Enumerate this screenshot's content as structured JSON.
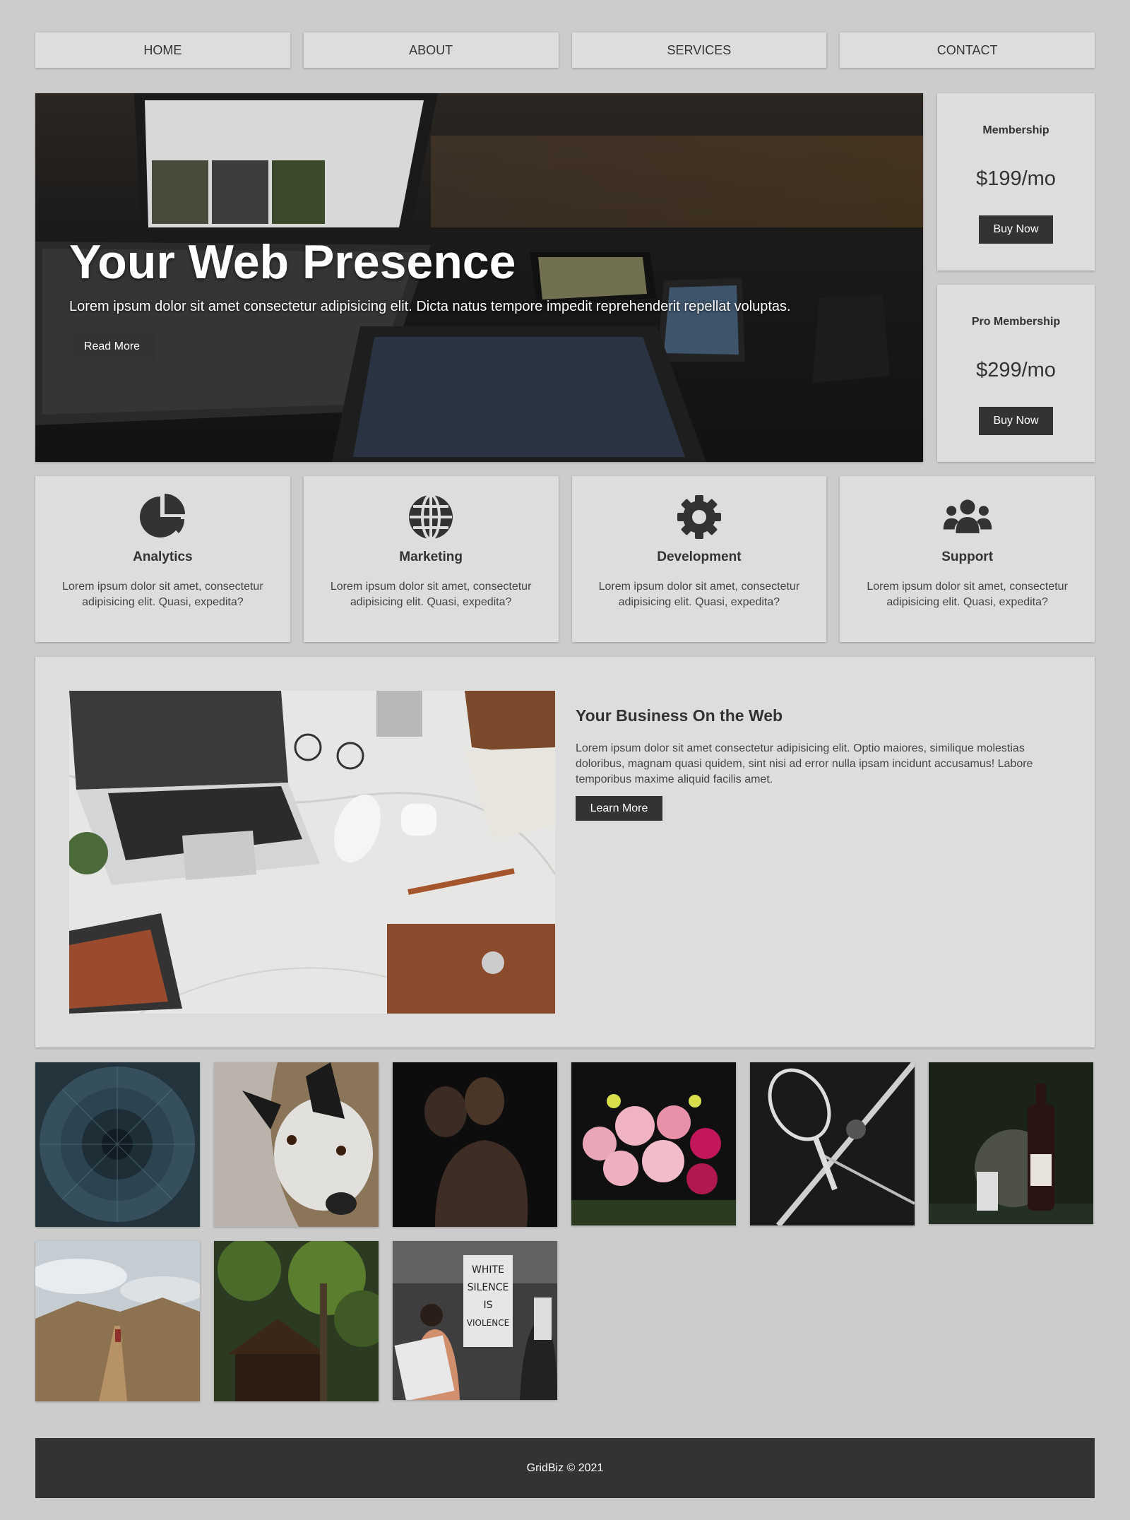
{
  "nav": {
    "items": [
      {
        "label": "HOME"
      },
      {
        "label": "ABOUT"
      },
      {
        "label": "SERVICES"
      },
      {
        "label": "CONTACT"
      }
    ]
  },
  "hero": {
    "title": "Your Web Presence",
    "text": "Lorem ipsum dolor sit amet consectetur adipisicing elit. Dicta natus tempore impedit reprehenderit repellat voluptas.",
    "button_label": "Read More"
  },
  "pricing": [
    {
      "title": "Membership",
      "price": "$199/mo",
      "button_label": "Buy Now"
    },
    {
      "title": "Pro Membership",
      "price": "$299/mo",
      "button_label": "Buy Now"
    }
  ],
  "services": [
    {
      "title": "Analytics",
      "icon": "chart-pie-icon",
      "text": "Lorem ipsum dolor sit amet, consectetur adipisicing elit. Quasi, expedita?"
    },
    {
      "title": "Marketing",
      "icon": "globe-icon",
      "text": "Lorem ipsum dolor sit amet, consectetur adipisicing elit. Quasi, expedita?"
    },
    {
      "title": "Development",
      "icon": "cog-icon",
      "text": "Lorem ipsum dolor sit amet, consectetur adipisicing elit. Quasi, expedita?"
    },
    {
      "title": "Support",
      "icon": "users-icon",
      "text": "Lorem ipsum dolor sit amet, consectetur adipisicing elit. Quasi, expedita?"
    }
  ],
  "feature": {
    "title": "Your Business On the Web",
    "text": "Lorem ipsum dolor sit amet consectetur adipisicing elit. Optio maiores, similique molestias doloribus, magnam quasi quidem, sint nisi ad error nulla ipsam incidunt accusamus! Labore temporibus maxime aliquid facilis amet.",
    "button_label": "Learn More"
  },
  "gallery": {
    "protest_sign": "WHITE SILENCE IS VIOLENCE"
  },
  "footer": {
    "text": "GridBiz © 2021"
  },
  "colors": {
    "page_bg": "#cccccc",
    "card_bg": "#dddddd",
    "dark": "#333333"
  }
}
